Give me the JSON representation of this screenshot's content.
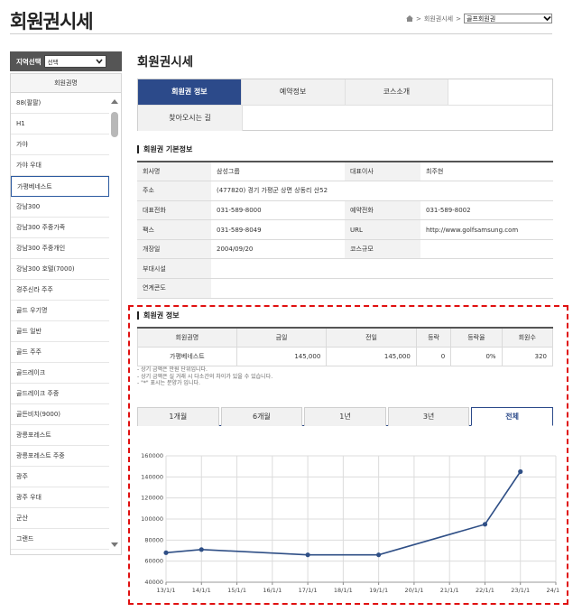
{
  "header": {
    "title": "회원권시세",
    "breadcrumb": [
      "회원권시세",
      "골프회원권"
    ],
    "breadcrumb_sep": ">",
    "select_value": "골프회원권"
  },
  "sidebar": {
    "region_label": "지역선택",
    "region_select": "선택",
    "list_header": "회원권명",
    "items": [
      "88(팔팔)",
      "H1",
      "가야",
      "가야 우대",
      "가평베네스트",
      "강남300",
      "강남300 주중가족",
      "강남300 주중개인",
      "강남300 호텔(7000)",
      "경주신라 주주",
      "골드 우기명",
      "골드 일반",
      "골드 주주",
      "골드레이크",
      "골드레이크 주중",
      "골든비치(9000)",
      "광릉포레스트",
      "광릉포레스트 주중",
      "광주",
      "광주 우대",
      "군산",
      "그랜드"
    ],
    "active_index": 4
  },
  "main": {
    "title": "회원권시세",
    "tabs": [
      "회원권 정보",
      "예약정보",
      "코스소개",
      "찾아오시는 길"
    ],
    "active_tab": 0
  },
  "basic_info": {
    "title": "회원권 기본정보",
    "rows": [
      {
        "k1": "회사명",
        "v1": "삼성그룹",
        "k2": "대표이사",
        "v2": "최주현"
      },
      {
        "k1": "주소",
        "v1": "(477820) 경기 가평군 상면 상동리 산52",
        "k2": "",
        "v2": ""
      },
      {
        "k1": "대표전화",
        "v1": "031-589-8000",
        "k2": "예약전화",
        "v2": "031-589-8002"
      },
      {
        "k1": "팩스",
        "v1": "031-589-8049",
        "k2": "URL",
        "v2": "http://www.golfsamsung.com"
      },
      {
        "k1": "개장일",
        "v1": "2004/09/20",
        "k2": "코스규모",
        "v2": ""
      },
      {
        "k1": "부대시설",
        "v1": "",
        "k2": "",
        "v2": ""
      },
      {
        "k1": "연계콘도",
        "v1": "",
        "k2": "",
        "v2": ""
      }
    ]
  },
  "price_info": {
    "title": "회원권 정보",
    "headers": [
      "회원권명",
      "금일",
      "전일",
      "등락",
      "등락율",
      "회원수"
    ],
    "row": [
      "가평베네스트",
      "145,000",
      "145,000",
      "0",
      "0%",
      "320"
    ],
    "notes": [
      "- 상기 금액은 만원 단위입니다.",
      "- 상기 금액은 실 거래 시 다소간의 차이가 있을 수 있습니다.",
      "- \"*\" 표시는 분양가 입니다."
    ]
  },
  "period_tabs": [
    "1개월",
    "6개월",
    "1년",
    "3년",
    "전체"
  ],
  "active_period": 4,
  "colors": {
    "accent": "#2c4a8a",
    "line": "#2f4f86",
    "highlight": "#e01010"
  },
  "chart_data": {
    "type": "line",
    "x_ticks": [
      "13/1/1",
      "14/1/1",
      "15/1/1",
      "16/1/1",
      "17/1/1",
      "18/1/1",
      "19/1/1",
      "20/1/1",
      "21/1/1",
      "22/1/1",
      "23/1/1",
      "24/1/1"
    ],
    "y_ticks": [
      40000,
      60000,
      80000,
      100000,
      120000,
      140000,
      160000
    ],
    "ylim": [
      40000,
      160000
    ],
    "xlim": [
      "13/1/1",
      "24/1/1"
    ],
    "series": [
      {
        "x": [
          "2013-01-01",
          "2014-01-01",
          "2017-01-01",
          "2019-01-01",
          "2022-01-01",
          "2023-01-01"
        ],
        "values": [
          68000,
          71000,
          66000,
          66000,
          95000,
          145000
        ]
      }
    ],
    "grid": true,
    "legend": "none"
  }
}
